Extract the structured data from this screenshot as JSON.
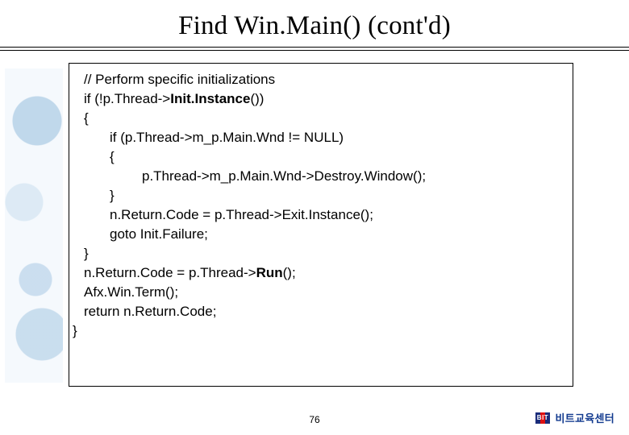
{
  "title": "Find Win.Main() (cont'd)",
  "code": {
    "l1": "// Perform specific initializations",
    "l2_a": "if (!p.Thread->",
    "l2_b": "Init.Instance",
    "l2_c": "())",
    "l3": "{",
    "l4": "if (p.Thread->m_p.Main.Wnd != NULL)",
    "l5": "{",
    "l6": "p.Thread->m_p.Main.Wnd->Destroy.Window();",
    "l7": "}",
    "l8": "n.Return.Code = p.Thread->Exit.Instance();",
    "l9": "goto Init.Failure;",
    "l10": "}",
    "l11_a": "n.Return.Code = p.Thread->",
    "l11_b": "Run",
    "l11_c": "();",
    "l12": "Afx.Win.Term();",
    "l13": "return n.Return.Code;",
    "l14": "}"
  },
  "page_number": "76",
  "footer": {
    "logo_text": "BIT",
    "org_label": "비트교육센터"
  }
}
